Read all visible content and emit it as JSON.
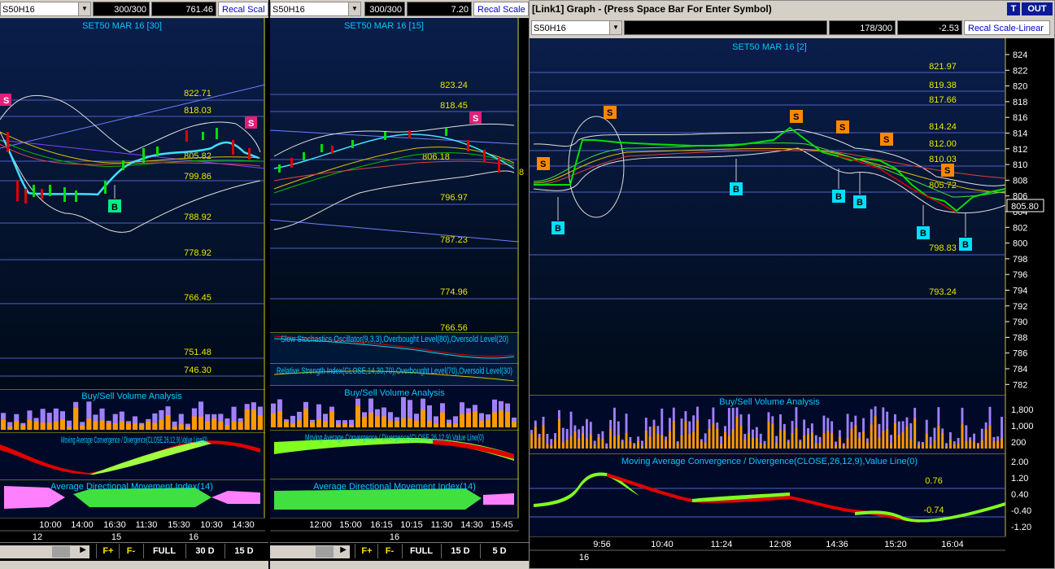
{
  "panels": [
    {
      "symbol": "S50H16",
      "count": "300/300",
      "value": "761.46",
      "recal": "Recal Scal",
      "title": "SET50 MAR 16  [30]",
      "levels": [
        "822.71",
        "818.03",
        "805.82",
        "799.86",
        "788.92",
        "778.92",
        "766.45",
        "751.48",
        "746.30"
      ],
      "volume_title": "Buy/Sell Volume Analysis",
      "macd_title": "Moving Average Convergence / Divergence(CLOSE,26,12,9),Value Line(0)",
      "adx_title": "Average Directional Movement Index(14)",
      "times": [
        "10:00",
        "14:00",
        "16:30",
        "11:30",
        "15:30",
        "10:30",
        "14:30"
      ],
      "dates": [
        "12",
        "15",
        "16"
      ],
      "bottom_buttons": [
        "F+",
        "F-",
        "FULL",
        "30 D",
        "15 D"
      ]
    },
    {
      "symbol": "S50H16",
      "count": "300/300",
      "value": "7.20",
      "recal": "Recal Scale",
      "title": "SET50 MAR 16  [15]",
      "levels": [
        "823.24",
        "818.45",
        "806.18",
        "796.97",
        "787.23",
        "774.96",
        "766.56"
      ],
      "stoch_title": "Slow Stochastics Oscillator(9,3,3),Overbought Level(80),Oversold Level(20)",
      "rsi_title": "Relative Strength Index(CLOSE,14,30,70),Overbought Level(70),Oversold Level(30)",
      "volume_title": "Buy/Sell Volume Analysis",
      "macd_title": "Moving Average Convergence / Divergence(CLOSE,26,12,9),Value Line(0)",
      "adx_title": "Average Directional Movement Index(14)",
      "times": [
        "12:00",
        "15:00",
        "16:15",
        "10:15",
        "11:30",
        "14:30",
        "15:45"
      ],
      "dates": [
        "16"
      ],
      "bottom_buttons": [
        "F+",
        "F-",
        "FULL",
        "15 D",
        "5 D"
      ]
    },
    {
      "window_title": "[Link1] Graph  - (Press Space Bar For Enter Symbol)",
      "t_button": "T",
      "out_button": "OUT",
      "symbol": "S50H16",
      "count": "178/300",
      "value": "-2.53",
      "recal": "Recal Scale-Linear",
      "title": "SET50 MAR 16  [2]",
      "levels": [
        "821.97",
        "819.38",
        "817.66",
        "814.24",
        "812.00",
        "810.03",
        "805.72",
        "798.83",
        "793.24"
      ],
      "last_price": "805.80",
      "price_axis": [
        "824",
        "822",
        "820",
        "818",
        "816",
        "814",
        "812",
        "810",
        "808",
        "806",
        "804",
        "802",
        "800",
        "798",
        "796",
        "794",
        "792",
        "790",
        "788",
        "786",
        "784",
        "782"
      ],
      "volume_title": "Buy/Sell Volume Analysis",
      "volume_axis": [
        "1,800",
        "1,000",
        "200"
      ],
      "macd_title": "Moving Average Convergence / Divergence(CLOSE,26,12,9),Value Line(0)",
      "macd_axis": [
        "2.00",
        "1.20",
        "0.40",
        "-0.40",
        "-1.20"
      ],
      "macd_values": [
        "0.76",
        "-0.74"
      ],
      "times": [
        "9:56",
        "10:40",
        "11:24",
        "12:08",
        "14:36",
        "15:20",
        "16:04"
      ],
      "dates": [
        "16"
      ]
    }
  ],
  "colors": {
    "title_cyan": "#00c8ff",
    "level_yellow": "#e8e800",
    "candle_green": "#00e000",
    "candle_red": "#e00000",
    "sell_marker": "#ff8800",
    "buy_marker": "#00e0ff",
    "macd_green": "#80ff20",
    "adx_pink": "#ff80ff",
    "volume_purple": "#a080ff",
    "volume_orange": "#ff9900"
  }
}
